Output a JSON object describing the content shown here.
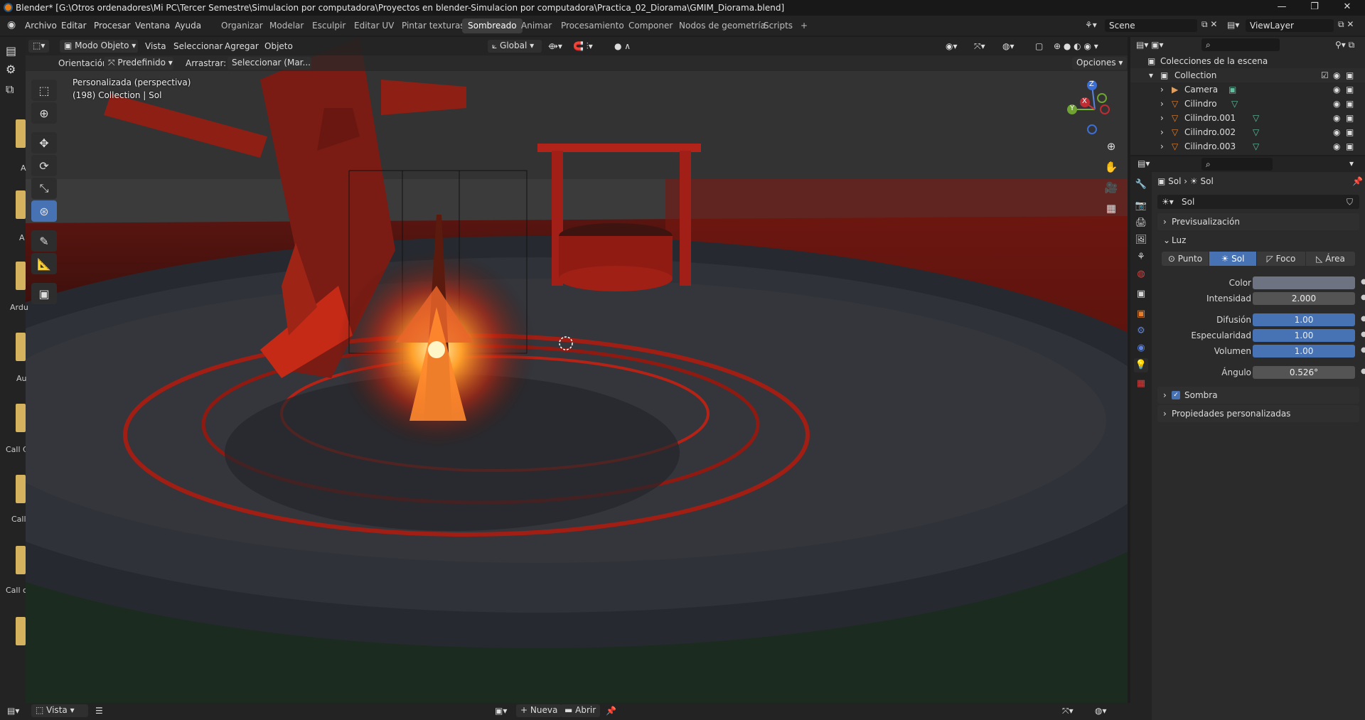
{
  "window": {
    "title": "Blender* [G:\\Otros ordenadores\\Mi PC\\Tercer Semestre\\Simulacion por computadora\\Proyectos en blender-Simulacion por computadora\\Practica_02_Diorama\\GMIM_Diorama.blend]",
    "minimize": "—",
    "maximize": "❐",
    "close": "✕"
  },
  "menu": [
    "Archivo",
    "Editar",
    "Procesar",
    "Ventana",
    "Ayuda"
  ],
  "workspaces": [
    "Organizar",
    "Modelar",
    "Esculpir",
    "Editar UV",
    "Pintar texturas",
    "Sombreado",
    "Animar",
    "Procesamiento",
    "Componer",
    "Nodos de geometría",
    "Scripts"
  ],
  "active_workspace": "Sombreado",
  "add_workspace": "+",
  "scene": "Scene",
  "view_layer": "ViewLayer",
  "viewport_header": {
    "mode": "Modo Objeto",
    "menus": [
      "Vista",
      "Seleccionar",
      "Agregar",
      "Objeto"
    ],
    "transform_orientation": "Global"
  },
  "tool_settings": {
    "orientation_label": "Orientación:",
    "orientation_value": "Predefinido",
    "drag_label": "Arrastrar:",
    "drag_value": "Seleccionar (Mar...",
    "options": "Opciones"
  },
  "viewport": {
    "view_name": "Personalizada (perspectiva)",
    "context": "(198) Collection | Sol",
    "gizmo_axes": {
      "z": "Z",
      "y": "Y",
      "x": "X"
    }
  },
  "left_strip_labels": [
    "A",
    "A",
    "Ardu",
    "Au",
    "Call C",
    "Call",
    "Call c"
  ],
  "statusbar": {
    "view": "Vista",
    "new": "Nueva",
    "open": "Abrir"
  },
  "outliner": {
    "root": "Colecciones de la escena",
    "collection": "Collection",
    "items": [
      {
        "name": "Camera",
        "icon": "camera-icon"
      },
      {
        "name": "Cilindro",
        "icon": "mesh-icon"
      },
      {
        "name": "Cilindro.001",
        "icon": "mesh-icon"
      },
      {
        "name": "Cilindro.002",
        "icon": "mesh-icon"
      },
      {
        "name": "Cilindro.003",
        "icon": "mesh-icon"
      }
    ]
  },
  "properties": {
    "breadcrumb_object": "Sol",
    "breadcrumb_data": "Sol",
    "datablock_name": "Sol",
    "panel_preview": "Previsualización",
    "panel_light": "Luz",
    "light_types": [
      "Punto",
      "Sol",
      "Foco",
      "Área"
    ],
    "active_light_type": "Sol",
    "fields": [
      {
        "label": "Color",
        "value": "",
        "style": "color"
      },
      {
        "label": "Intensidad",
        "value": "2.000",
        "style": "gray"
      },
      {
        "label": "Difusión",
        "value": "1.00",
        "style": "blue"
      },
      {
        "label": "Especularidad",
        "value": "1.00",
        "style": "blue"
      },
      {
        "label": "Volumen",
        "value": "1.00",
        "style": "blue"
      },
      {
        "label": "Ángulo",
        "value": "0.526°",
        "style": "gray"
      }
    ],
    "panel_shadow": "Sombra",
    "shadow_enabled": true,
    "panel_custom": "Propiedades personalizadas"
  },
  "colors": {
    "accent_blue": "#4772b3",
    "light_color_swatch": "#6e7382",
    "scene_red": "#b81c12",
    "fire": "#ff7a1a"
  }
}
